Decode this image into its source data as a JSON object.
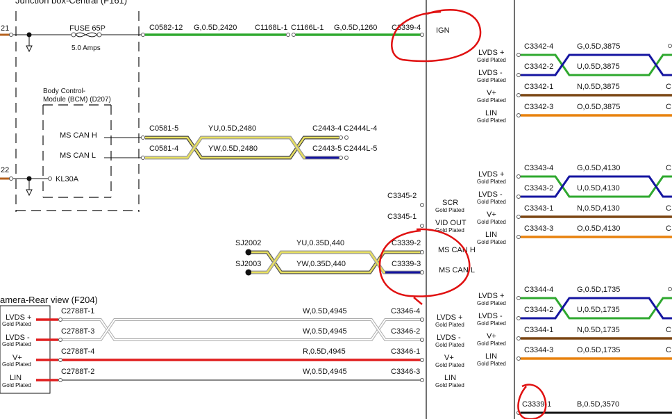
{
  "colors": {
    "green": "#2fa82f",
    "blue": "#1515a0",
    "brown": "#7a4512",
    "orange": "#e8820e",
    "red": "#e01e1e",
    "yellow": "#e8e060",
    "black": "#111111",
    "gray": "#aaaaaa",
    "annotation": "#e01010"
  },
  "top_left": {
    "title": "Junction box-Central (F161)",
    "left_num_21": "21",
    "left_num_22": "22",
    "fuse_label": "FUSE 65P",
    "fuse_amps": "5.0 Amps",
    "bcm_label_1": "Body Control-",
    "bcm_label_2": "Module (BCM) (D207)",
    "ms_can_h": "MS CAN H",
    "ms_can_l": "MS CAN L",
    "kl30a": "KL30A"
  },
  "ign_run": {
    "c0582": "C0582-12",
    "wire1": "G,0.5D,2420",
    "c1168": "C1168L-1",
    "c1166": "C1166L-1",
    "wire2": "G,0.5D,1260",
    "c3339_4": "C3339-4",
    "ign": "IGN"
  },
  "can_run": {
    "c0581_5": "C0581-5",
    "c0581_4": "C0581-4",
    "wire_yu": "YU,0.5D,2480",
    "wire_yw": "YW,0.5D,2480",
    "c2443_4": "C2443-4",
    "c2444l_4": "C2444L-4",
    "c2443_5": "C2443-5",
    "c2444l_5": "C2444L-5"
  },
  "middle": {
    "c3345_2": "C3345-2",
    "c3345_1": "C3345-1",
    "scr": "SCR",
    "vid_out": "VID OUT",
    "gold": "Gold Plated",
    "sj2002": "SJ2002",
    "sj2003": "SJ2003",
    "wire_yu": "YU,0.35D,440",
    "wire_yw": "YW,0.35D,440",
    "c3339_2": "C3339-2",
    "c3339_3": "C3339-3",
    "ms_can_h": "MS CAN H",
    "ms_can_l": "MS CAN L"
  },
  "camera": {
    "title": "amera-Rear view (F204)",
    "pin_lvds_p": "LVDS +",
    "pin_lvds_m": "LVDS -",
    "pin_v": "V+",
    "pin_lin": "LIN",
    "gold": "Gold Plated",
    "c2788_1": "C2788T-1",
    "c2788_3": "C2788T-3",
    "c2788_4": "C2788T-4",
    "c2788_2": "C2788T-2",
    "w1": "W,0.5D,4945",
    "w2": "W,0.5D,4945",
    "w3": "R,0.5D,4945",
    "w4": "W,0.5D,4945",
    "c3346_4": "C3346-4",
    "c3346_2": "C3346-2",
    "c3346_1": "C3346-1",
    "c3346_3": "C3346-3"
  },
  "right_pins": {
    "lvds_p": "LVDS +",
    "lvds_m": "LVDS -",
    "v": "V+",
    "lin": "LIN",
    "gold": "Gold Plated"
  },
  "right_groups": [
    {
      "c_g": "C3342-4",
      "w_g": "G,0.5D,3875",
      "c_u": "C3342-2",
      "w_u": "U,0.5D,3875",
      "c_n": "C3342-1",
      "w_n": "N,0.5D,3875",
      "c_o": "C3342-3",
      "w_o": "O,0.5D,3875",
      "edge": "C"
    },
    {
      "c_g": "C3343-4",
      "w_g": "G,0.5D,4130",
      "c_u": "C3343-2",
      "w_u": "U,0.5D,4130",
      "c_n": "C3343-1",
      "w_n": "N,0.5D,4130",
      "c_o": "C3343-3",
      "w_o": "O,0.5D,4130",
      "edge": "C"
    },
    {
      "c_g": "C3344-4",
      "w_g": "G,0.5D,1735",
      "c_u": "C3344-2",
      "w_u": "U,0.5D,1735",
      "c_n": "C3344-1",
      "w_n": "N,0.5D,1735",
      "c_o": "C3344-3",
      "w_o": "O,0.5D,1735",
      "edge": "C"
    }
  ],
  "bottom_right": {
    "c3339_1": "C3339-1",
    "wire": "B,0.5D,3570"
  }
}
